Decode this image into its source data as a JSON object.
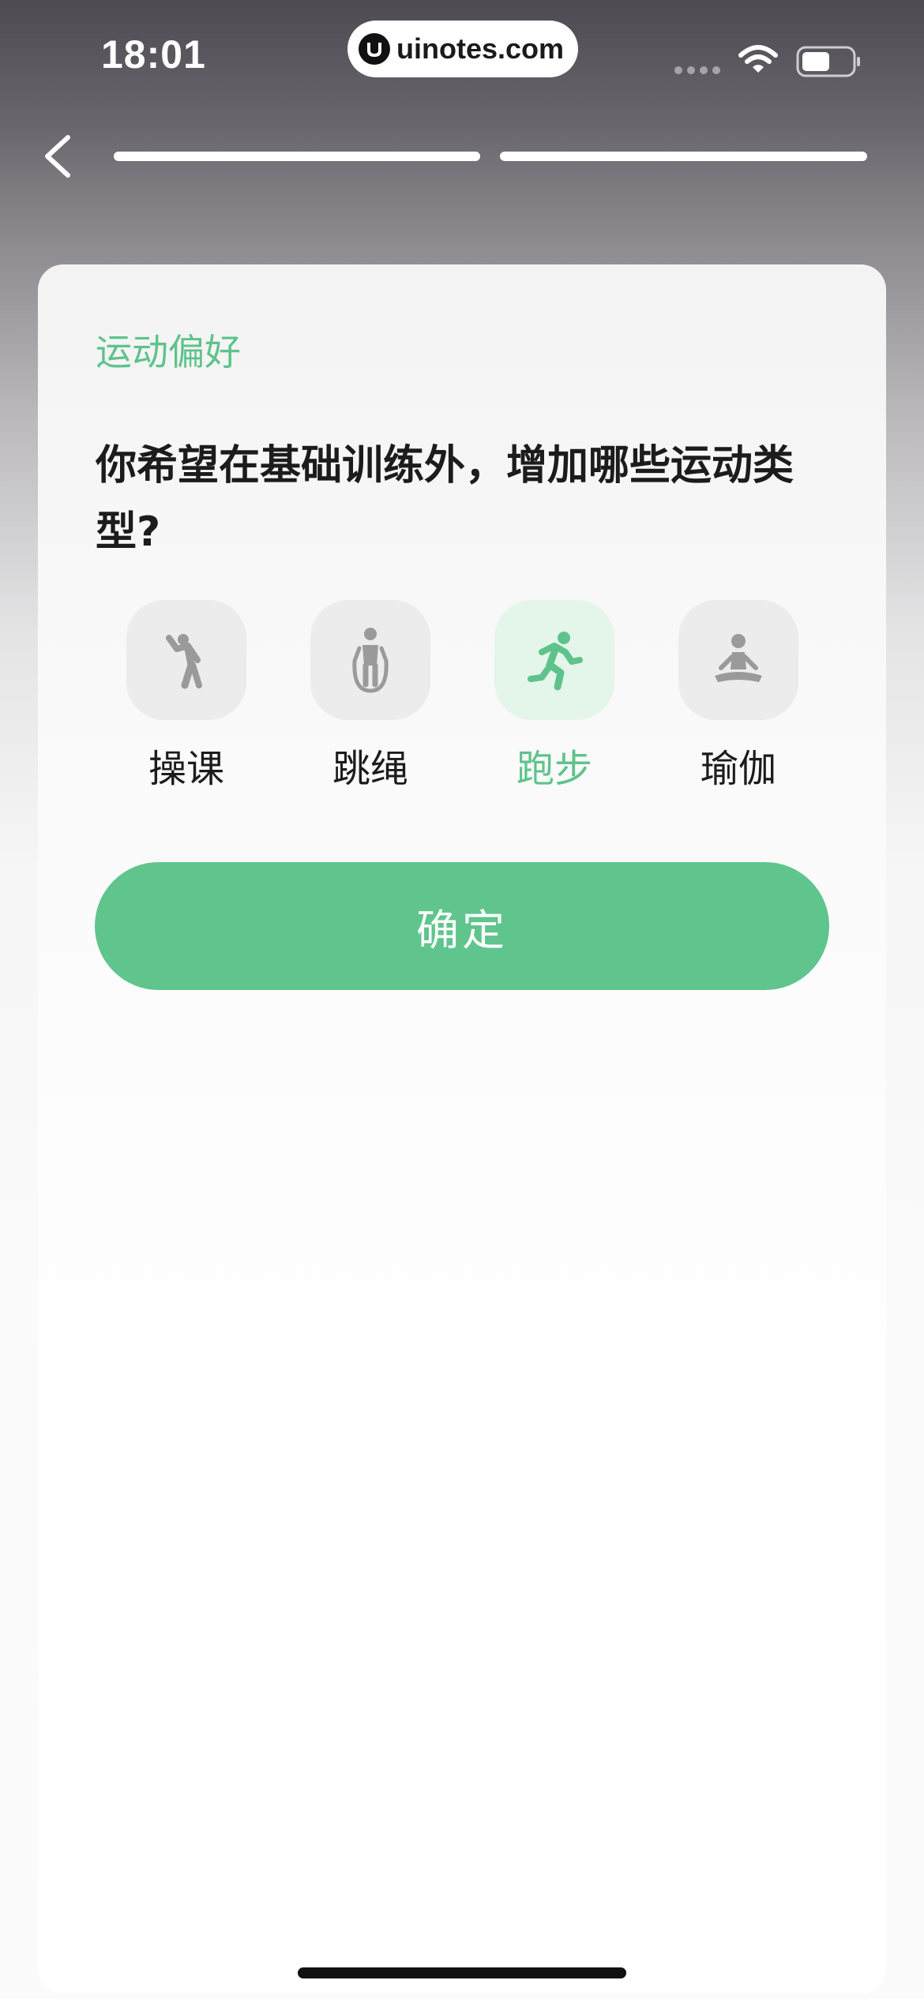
{
  "status_bar": {
    "time": "18:01",
    "site": "uinotes.com",
    "icons": [
      "signal-icon",
      "wifi-icon",
      "battery-icon"
    ]
  },
  "nav": {
    "back_icon": "chevron-left-icon",
    "progress_steps": 2,
    "progress_current": 2
  },
  "card": {
    "section_label": "运动偏好",
    "question": "你希望在基础训练外，增加哪些运动类型?",
    "options": [
      {
        "label": "操课",
        "icon": "aerobics-icon",
        "selected": false
      },
      {
        "label": "跳绳",
        "icon": "jump-rope-icon",
        "selected": false
      },
      {
        "label": "跑步",
        "icon": "running-icon",
        "selected": true
      },
      {
        "label": "瑜伽",
        "icon": "yoga-icon",
        "selected": false
      }
    ],
    "confirm_label": "确定"
  },
  "colors": {
    "accent": "#5fc58c",
    "accent_text": "#5ec38b",
    "icon_gray": "#9a9a9a",
    "icon_bg": "#ececec",
    "icon_bg_selected": "#e4f5ea"
  }
}
